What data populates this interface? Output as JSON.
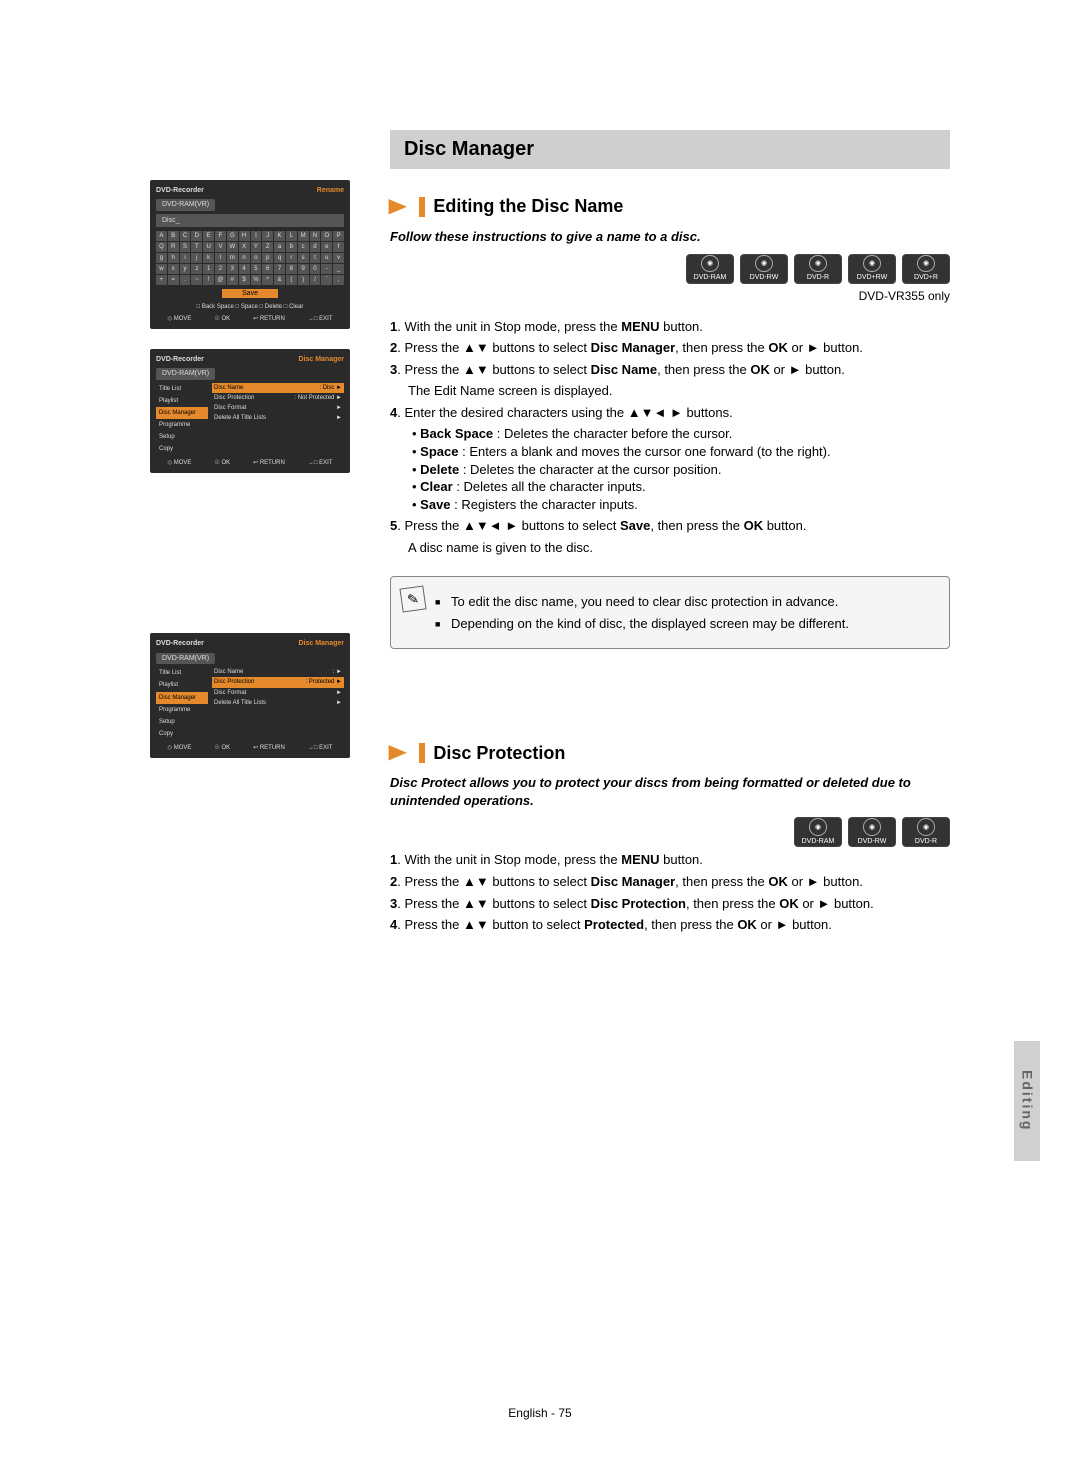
{
  "chapter": "Disc Manager",
  "section1": {
    "title": "Editing the Disc Name",
    "intro": "Follow these instructions to give a name to a disc.",
    "badges": [
      "DVD-RAM",
      "DVD-RW",
      "DVD-R",
      "DVD+RW",
      "DVD+R"
    ],
    "note": "DVD-VR355 only",
    "steps": [
      {
        "n": "1",
        "pre": ". With the unit in Stop mode, press the ",
        "b1": "MENU",
        "post": " button."
      },
      {
        "n": "2",
        "pre": ". Press the ▲▼ buttons to select ",
        "b1": "Disc Manager",
        "mid": ", then press the ",
        "b2": "OK",
        "post": " or ► button."
      },
      {
        "n": "3",
        "pre": ". Press the ▲▼ buttons to select ",
        "b1": "Disc Name",
        "mid": ", then press the ",
        "b2": "OK",
        "post": " or ► button.",
        "extra": "The Edit Name screen is displayed."
      },
      {
        "n": "4",
        "pre": ". Enter the desired characters using the ▲▼◄ ► buttons.",
        "subs": [
          {
            "k": "Back Space",
            "d": " : Deletes the character before the cursor."
          },
          {
            "k": "Space",
            "d": " : Enters a blank and moves the cursor one forward (to the right)."
          },
          {
            "k": "Delete",
            "d": " : Deletes the character at the cursor position."
          },
          {
            "k": "Clear",
            "d": " : Deletes all the character inputs."
          },
          {
            "k": "Save",
            "d": " : Registers the character inputs."
          }
        ]
      },
      {
        "n": "5",
        "pre": ". Press the ▲▼◄ ► buttons to select ",
        "b1": "Save",
        "mid": ", then press the ",
        "b2": "OK",
        "post": " button.",
        "extra": "A disc name is given to the disc."
      }
    ],
    "notes": [
      "To edit the disc name, you need to clear disc protection in advance.",
      "Depending on the kind of disc, the displayed screen may be different."
    ]
  },
  "section2": {
    "title": "Disc Protection",
    "intro": "Disc Protect allows you to protect your discs from being formatted or deleted due to unintended operations.",
    "badges": [
      "DVD-RAM",
      "DVD-RW",
      "DVD-R"
    ],
    "steps": [
      {
        "n": "1",
        "pre": ". With the unit in Stop mode, press the ",
        "b1": "MENU",
        "post": " button."
      },
      {
        "n": "2",
        "pre": ". Press the ▲▼ buttons to select ",
        "b1": "Disc Manager",
        "mid": ", then press the ",
        "b2": "OK",
        "post": " or ► button."
      },
      {
        "n": "3",
        "pre": ". Press the ▲▼ buttons to select ",
        "b1": "Disc Protection",
        "mid": ", then press the ",
        "b2": "OK",
        "post": " or ► button."
      },
      {
        "n": "4",
        "pre": ". Press the ▲▼ button to select ",
        "b1": "Protected",
        "mid": ", then press the ",
        "b2": "OK",
        "post": " or ► button."
      }
    ]
  },
  "osd1": {
    "title": "DVD-Recorder",
    "mode": "Rename",
    "src": "DVD-RAM(VR)",
    "input": "Disc_",
    "rows": [
      "A B C D E F G H I J K L M N O P",
      "Q R S T U V W X Y Z a b c d e f",
      "g h i j k l m n o p q r s t u v",
      "w x y z 1 2 3 4 5 6 7 8 9 0 - _",
      "+ = . ~ ! @ # $ % ^ & ( ) / ` ;"
    ],
    "save": "Save",
    "hints": "□ Back Space   □ Space   □ Delete   □ Clear",
    "foot": [
      "◇ MOVE",
      "☉ OK",
      "↩ RETURN",
      "→□ EXIT"
    ]
  },
  "osd2": {
    "title": "DVD-Recorder",
    "mode": "Disc Manager",
    "src": "DVD-RAM(VR)",
    "side": [
      "Title List",
      "Playlist",
      "Disc Manager",
      "Programme",
      "Setup",
      "Copy"
    ],
    "active": 2,
    "rows": [
      {
        "l": "Disc Name",
        "r": ": Disc",
        "sel": true
      },
      {
        "l": "Disc Protection",
        "r": ": Not Protected"
      },
      {
        "l": "Disc Format",
        "r": ""
      },
      {
        "l": "Delete All Title Lists",
        "r": ""
      }
    ],
    "foot": [
      "◇ MOVE",
      "☉ OK",
      "↩ RETURN",
      "→□ EXIT"
    ]
  },
  "osd3": {
    "title": "DVD-Recorder",
    "mode": "Disc Manager",
    "src": "DVD-RAM(VR)",
    "side": [
      "Title List",
      "Playlist",
      "Disc Manager",
      "Programme",
      "Setup",
      "Copy"
    ],
    "active": 2,
    "rows": [
      {
        "l": "Disc Name",
        "r": ":"
      },
      {
        "l": "Disc Protection",
        "r": ": Protected",
        "sel": true
      },
      {
        "l": "Disc Format",
        "r": ""
      },
      {
        "l": "Delete All Title Lists",
        "r": ""
      }
    ],
    "foot": [
      "◇ MOVE",
      "☉ OK",
      "↩ RETURN",
      "→□ EXIT"
    ]
  },
  "tab": "Editing",
  "footer": {
    "lang": "English",
    "page": "75"
  }
}
